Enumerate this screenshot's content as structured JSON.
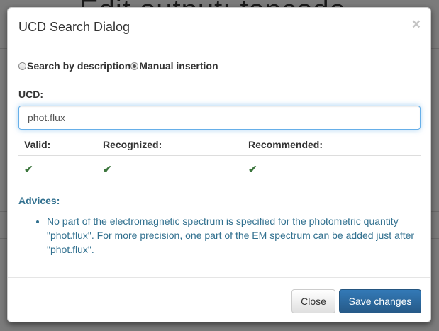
{
  "background": {
    "page_heading": "Edit output: tapcode"
  },
  "dialog": {
    "title": "UCD Search Dialog",
    "close_glyph": "×",
    "mode_options": [
      {
        "label": "Search by description",
        "checked": false
      },
      {
        "label": "Manual insertion",
        "checked": true
      }
    ],
    "ucd_label": "UCD:",
    "ucd_value": "phot.flux",
    "status_headers": [
      "Valid:",
      "Recognized:",
      "Recommended:"
    ],
    "status_values": [
      "✔",
      "✔",
      "✔"
    ],
    "advices_label": "Advices:",
    "advices": [
      "No part of the electromagnetic spectrum is specified for the photometric quantity \"phot.flux\". For more precision, one part of the EM spectrum can be added just after \"phot.flux\"."
    ],
    "close_button_label": "Close",
    "save_button_label": "Save changes"
  },
  "colors": {
    "primary": "#337ab7",
    "success": "#3c763d",
    "info_text": "#31708f",
    "focus_border": "#66afe9"
  },
  "icons": {
    "close": "close-icon",
    "check": "check-icon"
  }
}
